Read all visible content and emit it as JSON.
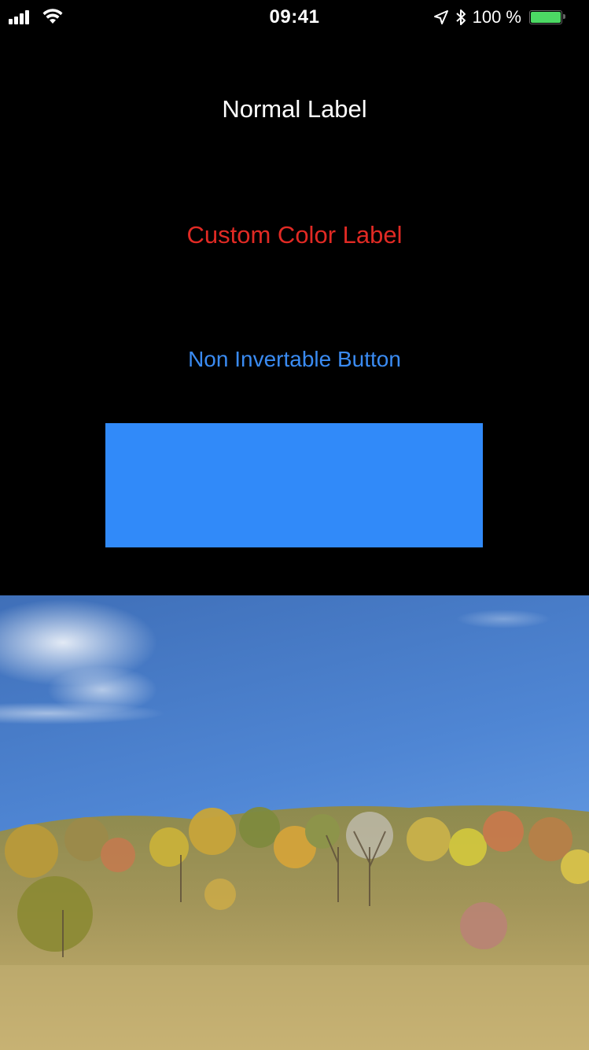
{
  "status_bar": {
    "time": "09:41",
    "battery_text": "100 %",
    "battery_color": "#4cd964",
    "icons": [
      "cellular-signal-icon",
      "wifi-icon",
      "location-arrow-icon",
      "bluetooth-icon",
      "battery-icon"
    ]
  },
  "content": {
    "normal_label": "Normal Label",
    "custom_color_label": "Custom Color Label",
    "custom_color": "#e12a24",
    "non_invertable_button": "Non Invertable Button",
    "button_color": "#3a8bf2",
    "blue_box_color": "#318af9"
  },
  "image": {
    "subject": "landscape-photo"
  }
}
